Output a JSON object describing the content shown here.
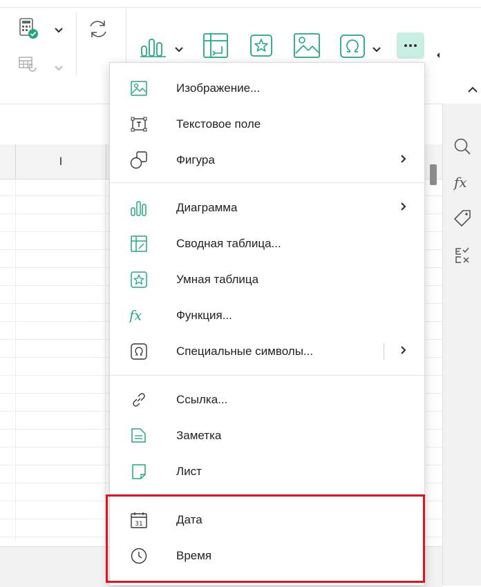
{
  "colors": {
    "accent": "#20a884",
    "accent_bg": "#c9efe4",
    "highlight": "#e0141f"
  },
  "toolbar": {
    "icons": [
      "calculator-check-icon",
      "chevron-down-icon",
      "refresh-icon",
      "table-refresh-icon",
      "chart-icon",
      "pivot-table-icon",
      "smart-table-icon",
      "image-icon",
      "omega-icon",
      "more-icon",
      "chevron-up-icon"
    ]
  },
  "sheet": {
    "column_header": "I"
  },
  "right_panel": {
    "icons": [
      "search-icon",
      "fx-icon",
      "tag-icon",
      "check-cross-icon"
    ]
  },
  "menu": {
    "items": [
      {
        "label": "Изображение...",
        "icon": "image-icon"
      },
      {
        "label": "Текстовое поле",
        "icon": "textbox-icon"
      },
      {
        "label": "Фигура",
        "icon": "shape-icon",
        "submenu": true
      },
      {
        "label": "Диаграмма",
        "icon": "chart-icon",
        "submenu": true
      },
      {
        "label": "Сводная таблица...",
        "icon": "pivot-table-icon"
      },
      {
        "label": "Умная таблица",
        "icon": "smart-table-icon"
      },
      {
        "label": "Функция...",
        "icon": "fx-icon"
      },
      {
        "label": "Специальные символы...",
        "icon": "omega-icon",
        "submenu": true
      },
      {
        "label": "Ссылка...",
        "icon": "link-icon"
      },
      {
        "label": "Заметка",
        "icon": "note-icon"
      },
      {
        "label": "Лист",
        "icon": "sheet-icon"
      },
      {
        "label": "Дата",
        "icon": "calendar-icon",
        "date_day": "31"
      },
      {
        "label": "Время",
        "icon": "clock-icon"
      }
    ]
  }
}
